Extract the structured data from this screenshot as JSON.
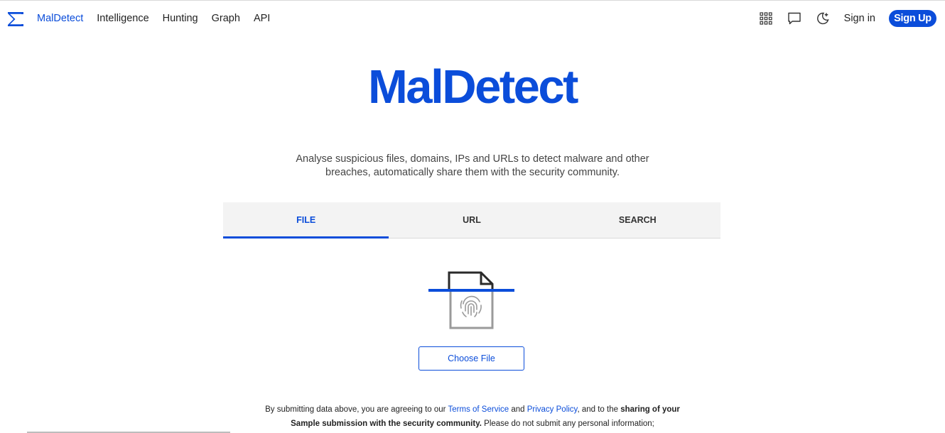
{
  "nav": {
    "brand": "MalDetect",
    "links": [
      "Intelligence",
      "Hunting",
      "Graph",
      "API"
    ],
    "icons": [
      "apps-grid-icon",
      "chat-bubble-icon",
      "dark-mode-moon-icon"
    ],
    "sign_in": "Sign in",
    "sign_up": "Sign Up"
  },
  "hero": {
    "title": "MalDetect",
    "tagline_line1": "Analyse suspicious files, domains, IPs and URLs to detect malware and other",
    "tagline_line2": "breaches, automatically share them with the security community."
  },
  "tabs": [
    {
      "label": "FILE",
      "active": true
    },
    {
      "label": "URL",
      "active": false
    },
    {
      "label": "SEARCH",
      "active": false
    }
  ],
  "upload": {
    "icon": "fingerprint-file-icon",
    "choose_label": "Choose File"
  },
  "disclaimer": {
    "part1": "By submitting data above, you are agreeing to our ",
    "tos": "Terms of Service",
    "and": " and ",
    "privacy": "Privacy Policy",
    "part2": ", and to the ",
    "bold1": "sharing of your",
    "bold2": "Sample submission with the security community.",
    "part3": " Please do not submit any personal information;"
  },
  "colors": {
    "accent": "#0b4dda",
    "tab_bg": "#f3f3f3"
  }
}
